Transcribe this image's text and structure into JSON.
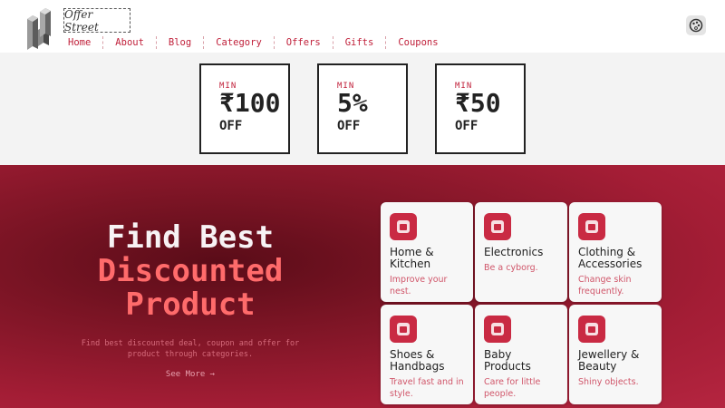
{
  "brand": {
    "name": "Offer Street"
  },
  "nav": [
    {
      "label": "Home"
    },
    {
      "label": "About"
    },
    {
      "label": "Blog"
    },
    {
      "label": "Category"
    },
    {
      "label": "Offers"
    },
    {
      "label": "Gifts"
    },
    {
      "label": "Coupons"
    }
  ],
  "theme_toggle": {
    "icon": "palette-icon"
  },
  "offers": [
    {
      "min": "MIN",
      "value": "₹100",
      "off": "OFF"
    },
    {
      "min": "MIN",
      "value": "5%",
      "off": "OFF"
    },
    {
      "min": "MIN",
      "value": "₹50",
      "off": "OFF"
    }
  ],
  "hero": {
    "title_line1": "Find Best",
    "title_line2": "Discounted",
    "title_line3": "Product",
    "subtitle": "Find best discounted deal, coupon and offer for product through categories.",
    "link": "See More →"
  },
  "categories": [
    {
      "name": "Home & Kitchen",
      "desc": "Improve your nest."
    },
    {
      "name": "Electronics",
      "desc": "Be a cyborg."
    },
    {
      "name": "Clothing & Accessories",
      "desc": "Change skin frequently."
    },
    {
      "name": "Shoes & Handbags",
      "desc": "Travel fast and in style."
    },
    {
      "name": "Baby Products",
      "desc": "Care for little people."
    },
    {
      "name": "Jewellery & Beauty",
      "desc": "Shiny objects."
    }
  ],
  "colors": {
    "accent": "#c0203a",
    "hero_dark": "#5a0c18",
    "hero_light": "#b52540",
    "highlight": "#ff6b6b"
  }
}
